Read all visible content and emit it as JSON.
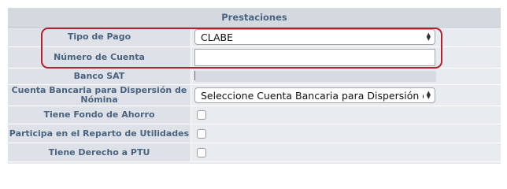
{
  "section": {
    "title": "Prestaciones"
  },
  "rows": {
    "tipo_pago": {
      "label": "Tipo de Pago",
      "value": "CLABE"
    },
    "numero_cuenta": {
      "label": "Número de Cuenta",
      "value": ""
    },
    "banco_sat": {
      "label": "Banco SAT"
    },
    "cuenta_bancaria": {
      "label": "Cuenta Bancaria para Dispersión de Nómina",
      "value": "Seleccione Cuenta Bancaria para Dispersión de"
    },
    "fondo_ahorro": {
      "label": "Tiene Fondo de Ahorro",
      "checked": false
    },
    "reparto_utilidades": {
      "label": "Participa en el Reparto de Utilidades",
      "checked": false
    },
    "derecho_ptu": {
      "label": "Tiene Derecho a PTU",
      "checked": false
    }
  },
  "icons": {
    "banco_sat_lookup": "list-icon"
  },
  "colors": {
    "header_text": "#4a6381",
    "highlight": "#b51f2e"
  }
}
